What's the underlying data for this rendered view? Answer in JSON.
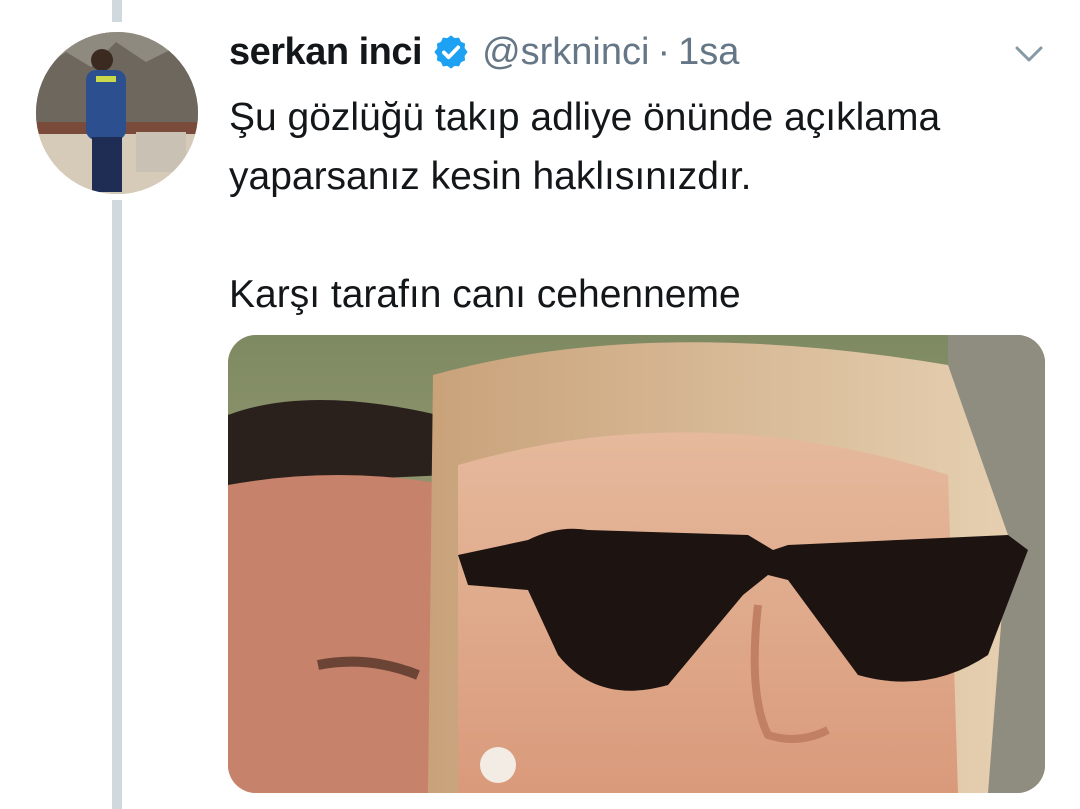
{
  "tweet": {
    "author": {
      "display_name": "serkan inci",
      "handle": "@srkninci",
      "verified": true,
      "avatar": "profile-photo"
    },
    "separator": "·",
    "timestamp": "1sa",
    "text": "Şu gözlüğü takıp adliye önünde açıklama\nyaparsanız kesin haklısınızdır.\n\nKarşı tarafın canı cehenneme",
    "media": "photo-woman-with-cat-eye-sunglasses",
    "menu_icon": "chevron-down-icon"
  },
  "colors": {
    "verified_blue": "#1da1f2",
    "thread_line": "#cfd9de",
    "muted_text": "#657786",
    "primary_text": "#14171a"
  }
}
